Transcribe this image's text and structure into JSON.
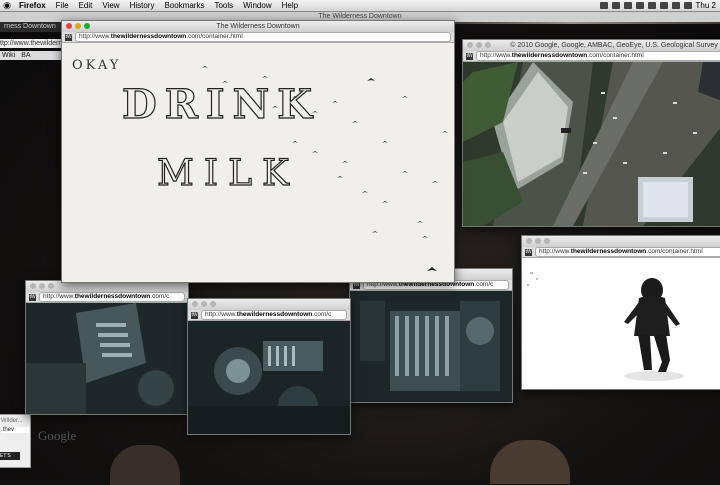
{
  "menubar": {
    "apple": "",
    "app": "Firefox",
    "items": [
      "File",
      "Edit",
      "View",
      "History",
      "Bookmarks",
      "Tools",
      "Window",
      "Help"
    ],
    "clock": "Thu 2"
  },
  "background": {
    "title": "The Wilderness Downtown",
    "tab": "rness Downtown",
    "address": "ttp://www.thewilderness",
    "bookmarks": [
      "Wiki",
      "BA"
    ],
    "brand": "Google",
    "footer_faint": "· · ·"
  },
  "mini_window": {
    "title": "Wilder...",
    "url": ".thev",
    "button": "ET'S"
  },
  "windows": {
    "main": {
      "title": "The Wilderness Downtown",
      "url_prefix": "http://www.",
      "url_domain": "thewildernessdowntown",
      "url_suffix": ".com/container.html",
      "favicon": "tW",
      "drawn_text": [
        "OKAY",
        "DRINK",
        "MILK"
      ]
    },
    "map": {
      "title": "© 2010 Google, Google, AMBAC, GeoEye, U.S. Geological Survey",
      "url_prefix": "http://www.",
      "url_domain": "thewildernessdowntown",
      "url_suffix": ".com/container.html",
      "favicon": "tW"
    },
    "runner": {
      "url_prefix": "http://www.",
      "url_domain": "thewildernessdowntown",
      "url_suffix": ".com/container.html",
      "favicon": "tW"
    },
    "machine_a": {
      "url_prefix": "http://www.",
      "url_domain": "thewildernessdowntown",
      "url_suffix": ".com/c",
      "favicon": "tW"
    },
    "machine_b": {
      "url_prefix": "http://www.",
      "url_domain": "thewildernessdowntown",
      "url_suffix": ".com/c",
      "favicon": "tW"
    },
    "machine_c": {
      "url_prefix": "http://www.",
      "url_domain": "thewildernessdowntown",
      "url_suffix": ".com/c",
      "favicon": "tW"
    }
  }
}
